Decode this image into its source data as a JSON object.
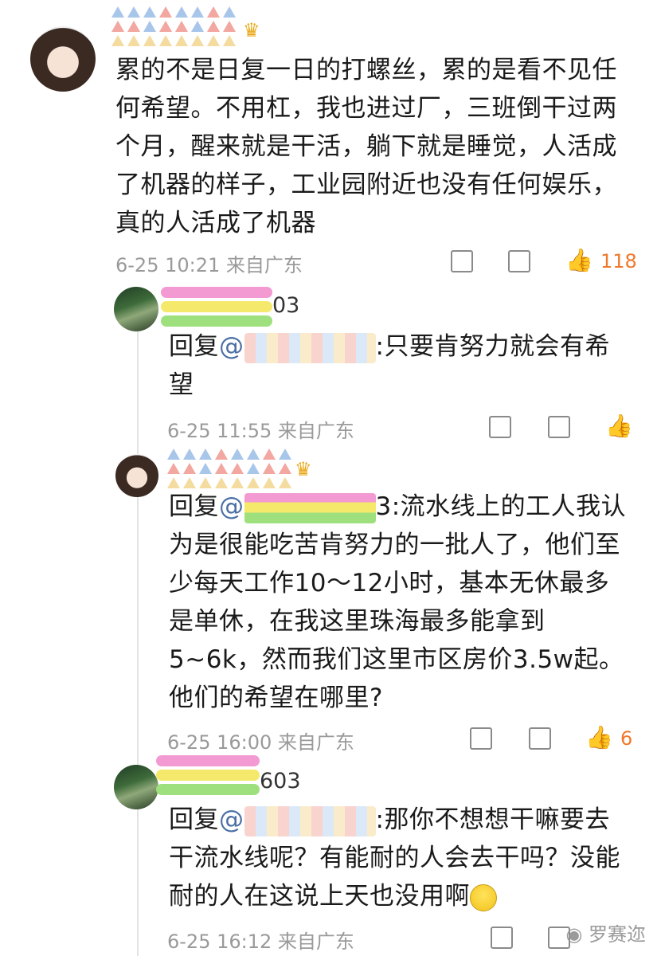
{
  "comments": [
    {
      "text": "累的不是日复一日的打螺丝，累的是看不见任何希望。不用杠，我也进过厂，三班倒干过两个月，醒来就是干活，躺下就是睡觉，人活成了机器的样子，工业园附近也没有任何娱乐，真的人活成了机器",
      "time": "6-25 10:21 来自广东",
      "likes": "118"
    },
    {
      "name_suffix": "03",
      "reply_prefix": "回复",
      "at": "@",
      "text": ":只要肯努力就会有希望",
      "time": "6-25 11:55 来自广东"
    },
    {
      "reply_prefix": "回复",
      "at": "@",
      "text": "3:流水线上的工人我认为是很能吃苦肯努力的一批人了，他们至少每天工作10～12小时，基本无休最多是单休，在我这里珠海最多能拿到5~6k，然而我们这里市区房价3.5w起。他们的希望在哪里?",
      "time": "6-25 16:00 来自广东",
      "likes": "6"
    },
    {
      "name_suffix": "603",
      "reply_prefix": "回复",
      "at": "@",
      "text": ":那你不想想干嘛要去干流水线呢？有能耐的人会去干吗？没能耐的人在这说上天也没用啊",
      "time": "6-25 16:12 来自广东"
    }
  ],
  "watermark": "罗赛迩",
  "icons": {
    "share": "share-icon",
    "comment": "comment-icon",
    "like": "like-icon",
    "crown": "crown-icon",
    "smile": "smile-emoji-icon"
  },
  "colors": {
    "like_active": "#f0782a",
    "meta": "#9a9a9a",
    "mention": "#4a6fa5"
  }
}
